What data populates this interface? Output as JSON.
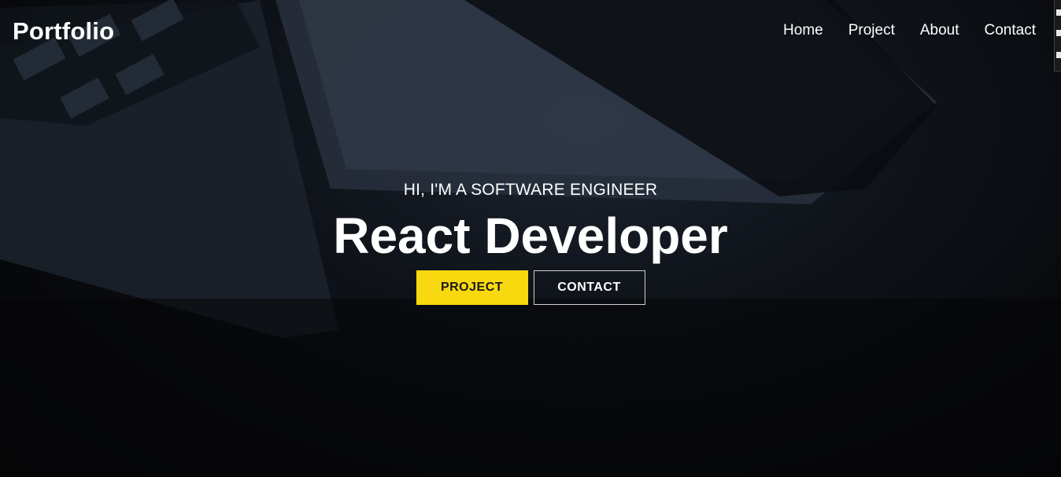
{
  "navbar": {
    "brand": "Portfolio",
    "links": [
      {
        "label": "Home"
      },
      {
        "label": "Project"
      },
      {
        "label": "About"
      },
      {
        "label": "Contact"
      }
    ]
  },
  "hero": {
    "subtitle": "HI, I'M A SOFTWARE ENGINEER",
    "headline": "React Developer",
    "buttons": {
      "primary_label": "PROJECT",
      "secondary_label": "CONTACT"
    }
  },
  "colors": {
    "accent": "#f8d90f",
    "background": "#0b0c10",
    "text": "#ffffff"
  }
}
